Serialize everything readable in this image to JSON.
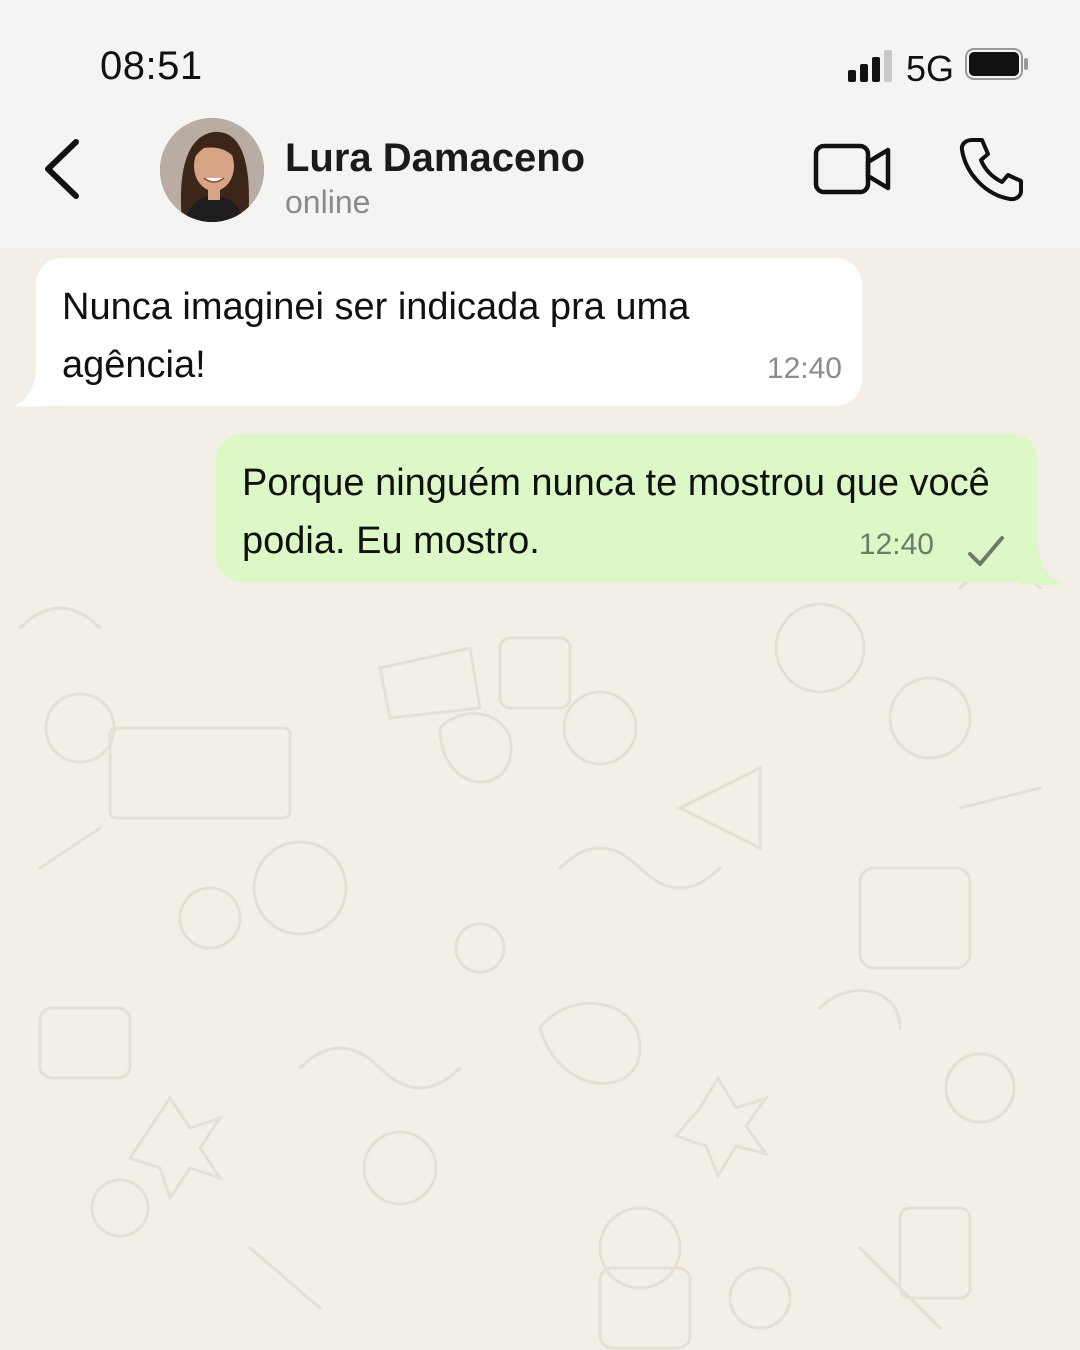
{
  "status_bar": {
    "time": "08:51",
    "network": "5G",
    "signal_icon": "signal-bars-icon",
    "battery_icon": "battery-icon"
  },
  "header": {
    "back_icon": "chevron-left-icon",
    "contact_name": "Lura Damaceno",
    "contact_status": "online",
    "video_icon": "video-camera-icon",
    "phone_icon": "phone-icon"
  },
  "messages": [
    {
      "direction": "incoming",
      "text": "Nunca imaginei ser indicada pra uma agência!",
      "time": "12:40"
    },
    {
      "direction": "outgoing",
      "text": "Porque ninguém nunca te mostrou que você podia. Eu mostro.",
      "time": "12:40",
      "status_icon": "single-check-icon"
    }
  ],
  "colors": {
    "incoming_bubble": "#ffffff",
    "outgoing_bubble": "#dcf8c6",
    "chat_background": "#f3efe7",
    "header_background": "#f4f4f2"
  }
}
